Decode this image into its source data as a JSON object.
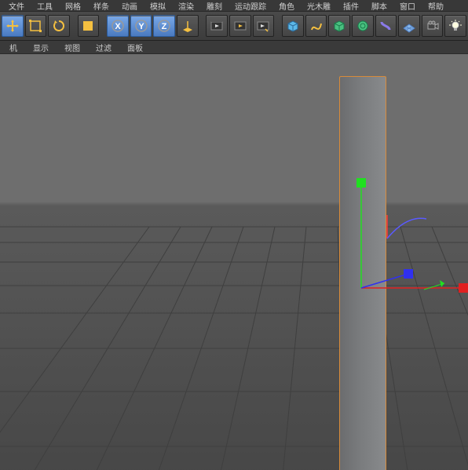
{
  "menu": {
    "items": [
      "文件",
      "工具",
      "网格",
      "样条",
      "动画",
      "模拟",
      "渲染",
      "雕刻",
      "运动跟踪",
      "角色",
      "光木雕",
      "插件",
      "脚本",
      "窗口",
      "帮助"
    ]
  },
  "subbar": {
    "items": [
      "机",
      "显示",
      "视图",
      "过滤",
      "面板"
    ]
  },
  "toolbar": {
    "move": "移动",
    "scale": "缩放",
    "rotate": "旋转",
    "recent": "最近",
    "x": "X",
    "y": "Y",
    "z": "Z",
    "coord": "坐标",
    "play1": "播放",
    "play2": "播放范围",
    "play3": "录制",
    "cube": "立方体",
    "spline": "样条",
    "nurbs": "曲面",
    "gen": "生成器",
    "def": "变形器",
    "floor": "地面",
    "cam": "摄像机",
    "light": "灯光"
  },
  "scene": {
    "selected_object": "立方体"
  }
}
